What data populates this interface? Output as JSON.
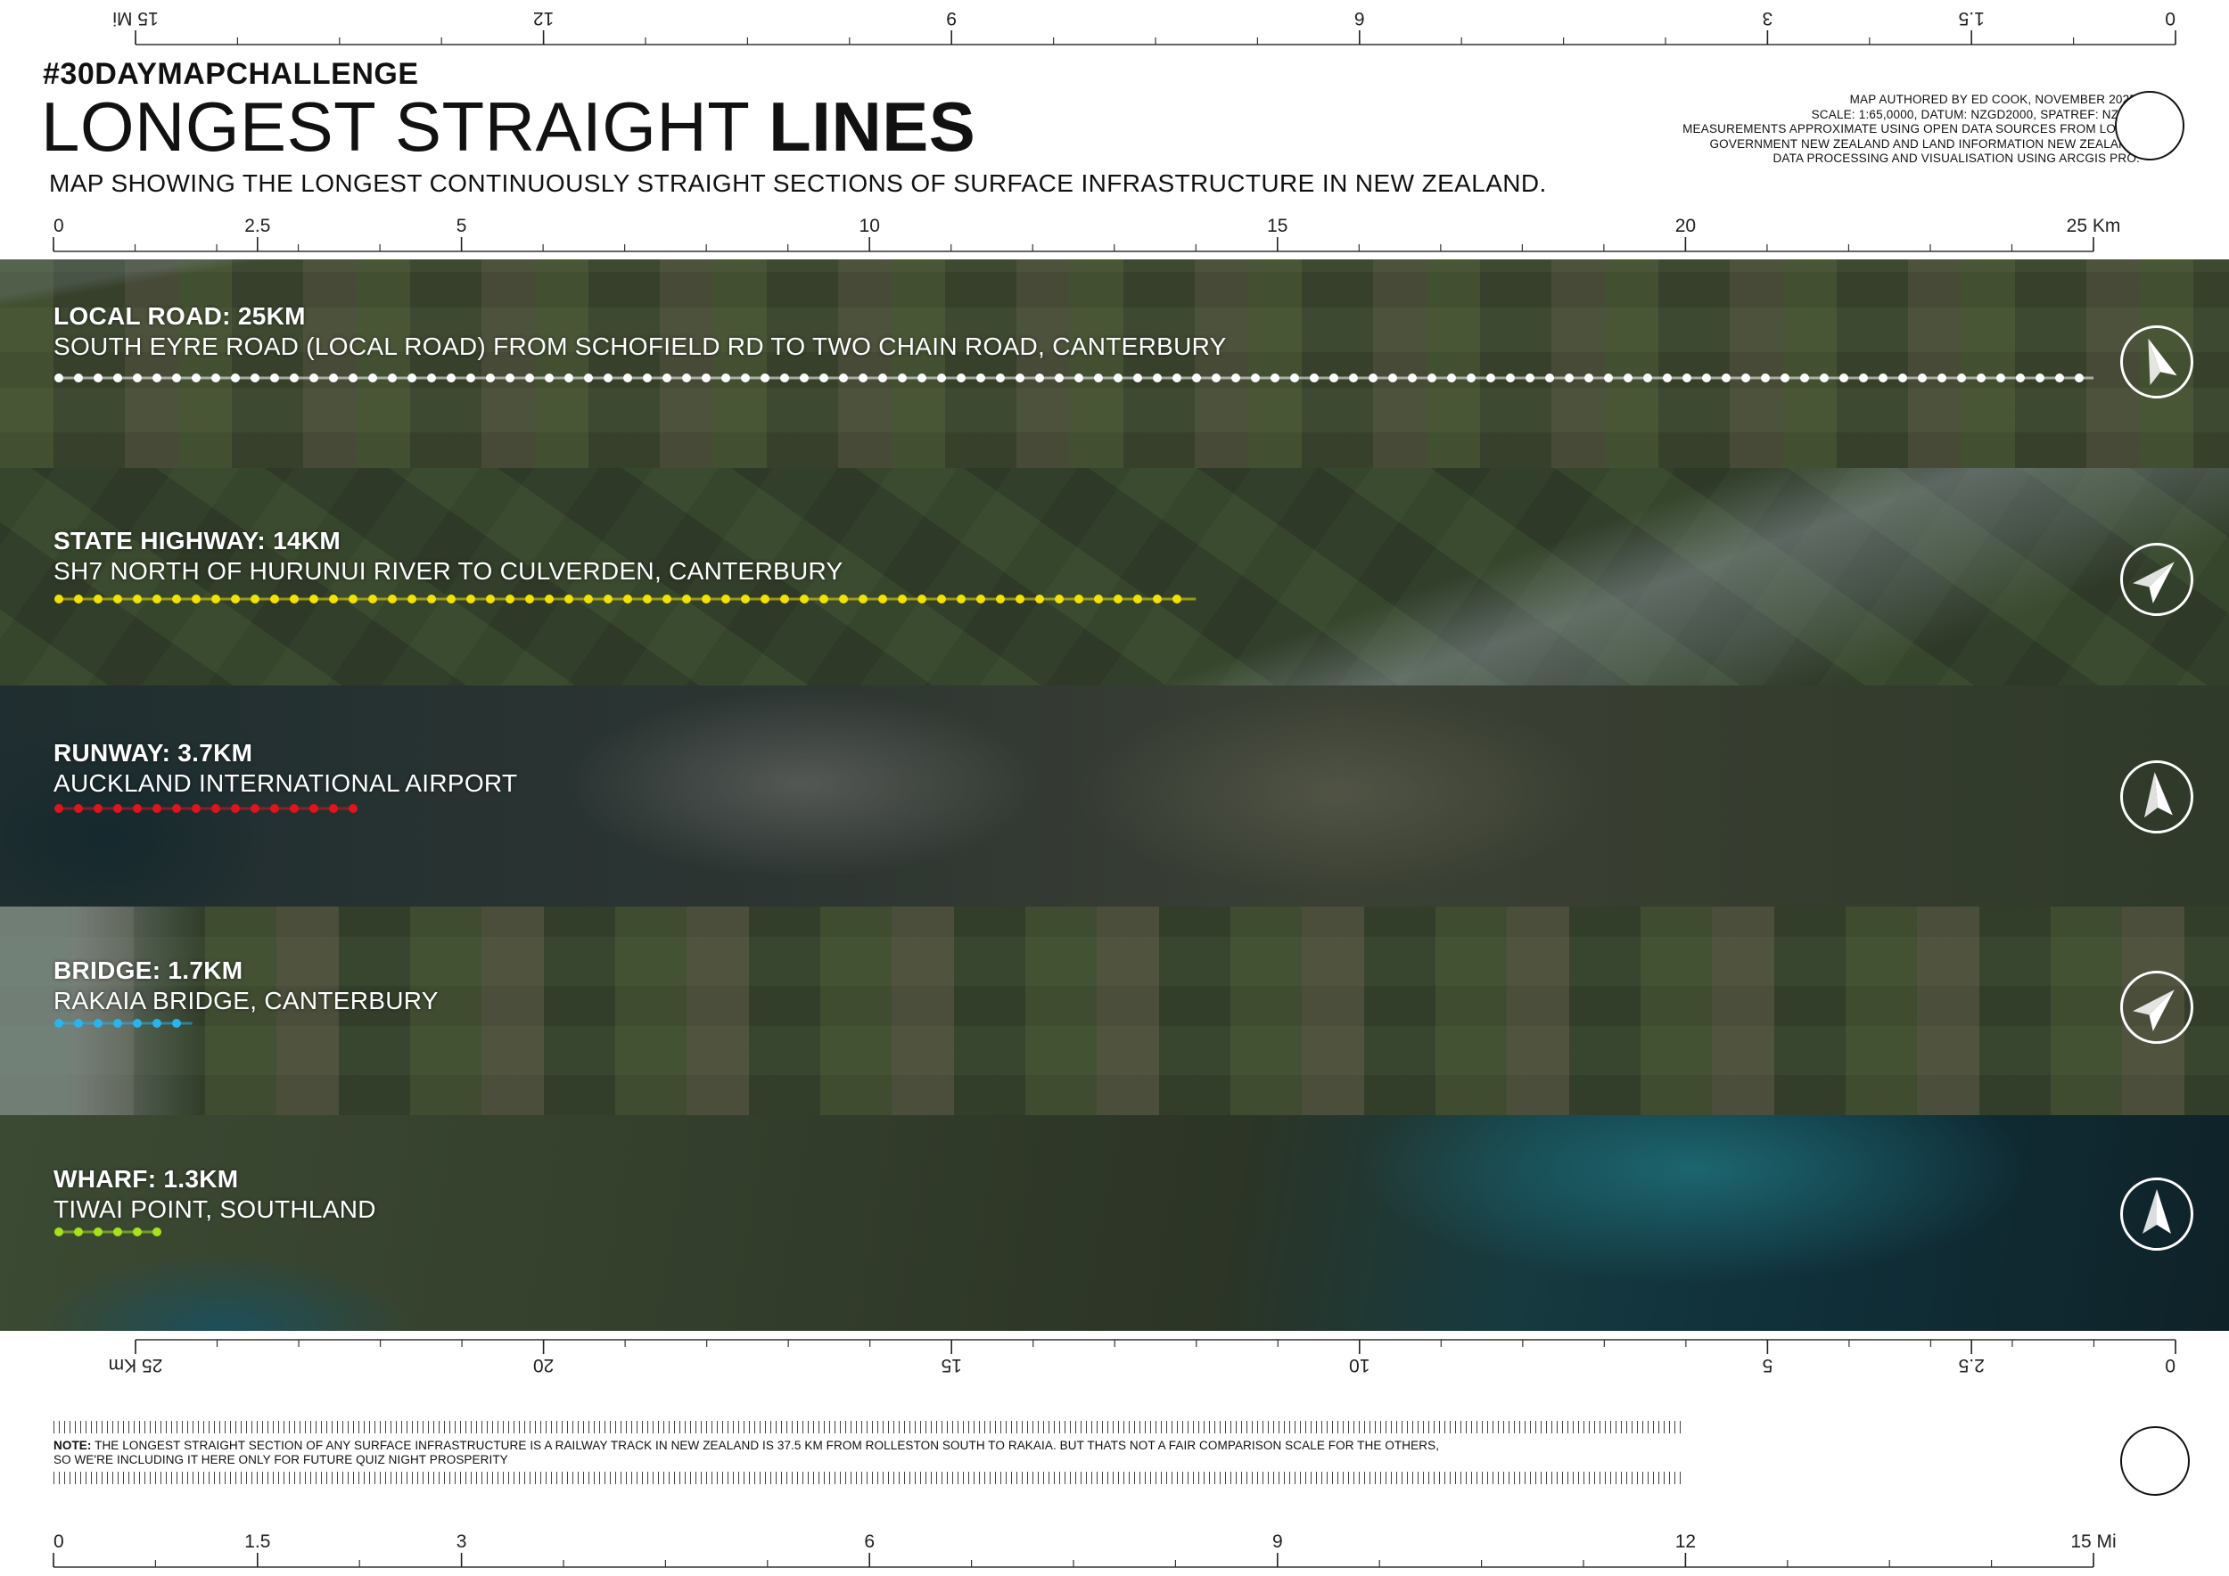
{
  "header": {
    "hashtag": "#30DAYMAPCHALLENGE",
    "title_regular": "LONGEST STRAIGHT ",
    "title_bold": "LINES",
    "subtitle": "MAP SHOWING THE LONGEST CONTINUOUSLY STRAIGHT SECTIONS OF SURFACE INFRASTRUCTURE IN NEW ZEALAND.",
    "credits": [
      "MAP AUTHORED BY ED COOK, NOVEMBER 2025.",
      "SCALE: 1:65,0000, DATUM: NZGD2000, SPATREF: NZTM.",
      "MEASUREMENTS APPROXIMATE USING OPEN DATA SOURCES FROM LOCAL",
      "GOVERNMENT NEW ZEALAND AND LAND INFORMATION NEW ZEALAND.",
      "DATA PROCESSING AND VISUALISATION USING ARCGIS PRO."
    ]
  },
  "scales": {
    "top_miles": {
      "ticks": [
        "0",
        "1.5",
        "3",
        "6",
        "9",
        "12",
        "15 Mi"
      ]
    },
    "top_km": {
      "ticks": [
        "0",
        "2.5",
        "5",
        "10",
        "15",
        "20",
        "25 Km"
      ]
    },
    "bottom_km": {
      "ticks": [
        "0",
        "2.5",
        "5",
        "10",
        "15",
        "20",
        "25 Km"
      ]
    },
    "bottom_miles": {
      "ticks": [
        "0",
        "1.5",
        "3",
        "6",
        "9",
        "12",
        "15 Mi"
      ]
    }
  },
  "bands": [
    {
      "heading": "LOCAL ROAD: 25KM",
      "description": "SOUTH EYRE ROAD (LOCAL ROAD) FROM SCHOFIELD RD TO TWO CHAIN ROAD, CANTERBURY",
      "length_km": 25,
      "dot_color": "#ffffff",
      "compass_bearing": -20,
      "bg": "#3a4430"
    },
    {
      "heading": "STATE HIGHWAY: 14KM",
      "description": "SH7 NORTH OF HURUNUI RIVER TO CULVERDEN, CANTERBURY",
      "length_km": 14,
      "dot_color": "#f2e200",
      "compass_bearing": 45,
      "bg": "#2f3a2a"
    },
    {
      "heading": "RUNWAY: 3.7KM",
      "description": "AUCKLAND INTERNATIONAL AIRPORT",
      "length_km": 3.7,
      "dot_color": "#e0141c",
      "compass_bearing": -5,
      "bg": "#2a3232"
    },
    {
      "heading": "BRIDGE: 1.7KM",
      "description": "RAKAIA BRIDGE, CANTERBURY",
      "length_km": 1.7,
      "dot_color": "#28b4ec",
      "compass_bearing": 45,
      "bg": "#34402d"
    },
    {
      "heading": "WHARF: 1.3KM",
      "description": "TIWAI POINT, SOUTHLAND",
      "length_km": 1.3,
      "dot_color": "#a6e21a",
      "compass_bearing": 0,
      "bg": "#1c2826"
    }
  ],
  "note": {
    "label": "NOTE:",
    "text": " THE LONGEST STRAIGHT SECTION OF ANY SURFACE INFRASTRUCTURE IS A RAILWAY TRACK IN NEW ZEALAND IS 37.5 KM FROM ROLLESTON SOUTH TO RAKAIA. BUT THATS NOT A FAIR COMPARISON SCALE FOR THE OTHERS,",
    "text2": "SO WE'RE INCLUDING IT HERE ONLY FOR FUTURE QUIZ NIGHT PROSPERITY"
  }
}
